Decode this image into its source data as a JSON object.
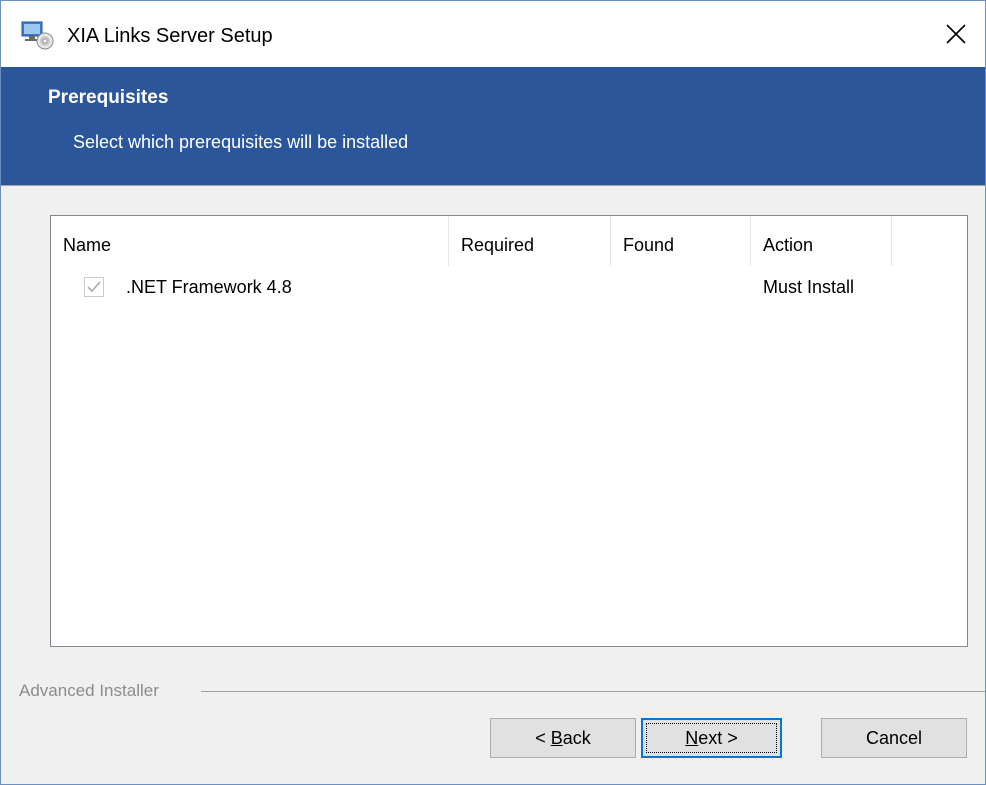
{
  "window": {
    "title": "XIA Links Server Setup",
    "icon": "installer-app-icon",
    "close_glyph": "✕"
  },
  "banner": {
    "title": "Prerequisites",
    "subtitle": "Select which prerequisites will be installed",
    "background_color": "#2b579a"
  },
  "prerequisites": {
    "columns": [
      "Name",
      "Required",
      "Found",
      "Action"
    ],
    "rows": [
      {
        "checked": true,
        "disabled": true,
        "name": ".NET Framework 4.8",
        "required": "",
        "found": "",
        "action": "Must Install"
      }
    ]
  },
  "branding": {
    "text": "Advanced Installer"
  },
  "buttons": {
    "back": {
      "prefix": "< ",
      "mnemonic": "B",
      "rest": "ack"
    },
    "next": {
      "mnemonic": "N",
      "rest": "ext >"
    },
    "cancel": {
      "label": "Cancel"
    }
  },
  "colors": {
    "accent": "#0078d7",
    "banner": "#2b579a"
  }
}
